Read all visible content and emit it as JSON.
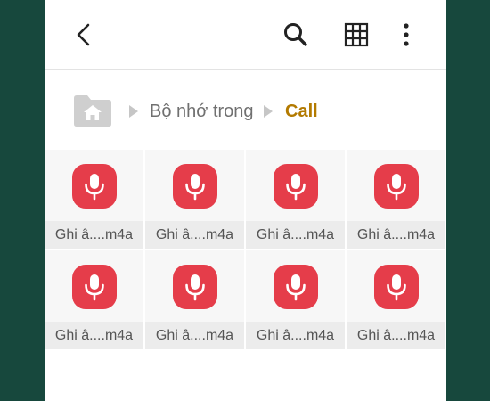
{
  "toolbar": {
    "back_icon": "back-arrow-icon",
    "search_icon": "search-icon",
    "grid_icon": "grid-view-icon",
    "more_icon": "more-vertical-icon"
  },
  "breadcrumb": {
    "home_icon": "home-folder-icon",
    "items": [
      "Bộ nhớ trong",
      "Call"
    ],
    "current_color": "#b37a00"
  },
  "files": [
    {
      "name": "Ghi â....m4a",
      "icon": "microphone-icon"
    },
    {
      "name": "Ghi â....m4a",
      "icon": "microphone-icon"
    },
    {
      "name": "Ghi â....m4a",
      "icon": "microphone-icon"
    },
    {
      "name": "Ghi â....m4a",
      "icon": "microphone-icon"
    },
    {
      "name": "Ghi â....m4a",
      "icon": "microphone-icon"
    },
    {
      "name": "Ghi â....m4a",
      "icon": "microphone-icon"
    },
    {
      "name": "Ghi â....m4a",
      "icon": "microphone-icon"
    },
    {
      "name": "Ghi â....m4a",
      "icon": "microphone-icon"
    }
  ],
  "colors": {
    "accent_red": "#e53d4a",
    "frame_green": "#17483d"
  }
}
